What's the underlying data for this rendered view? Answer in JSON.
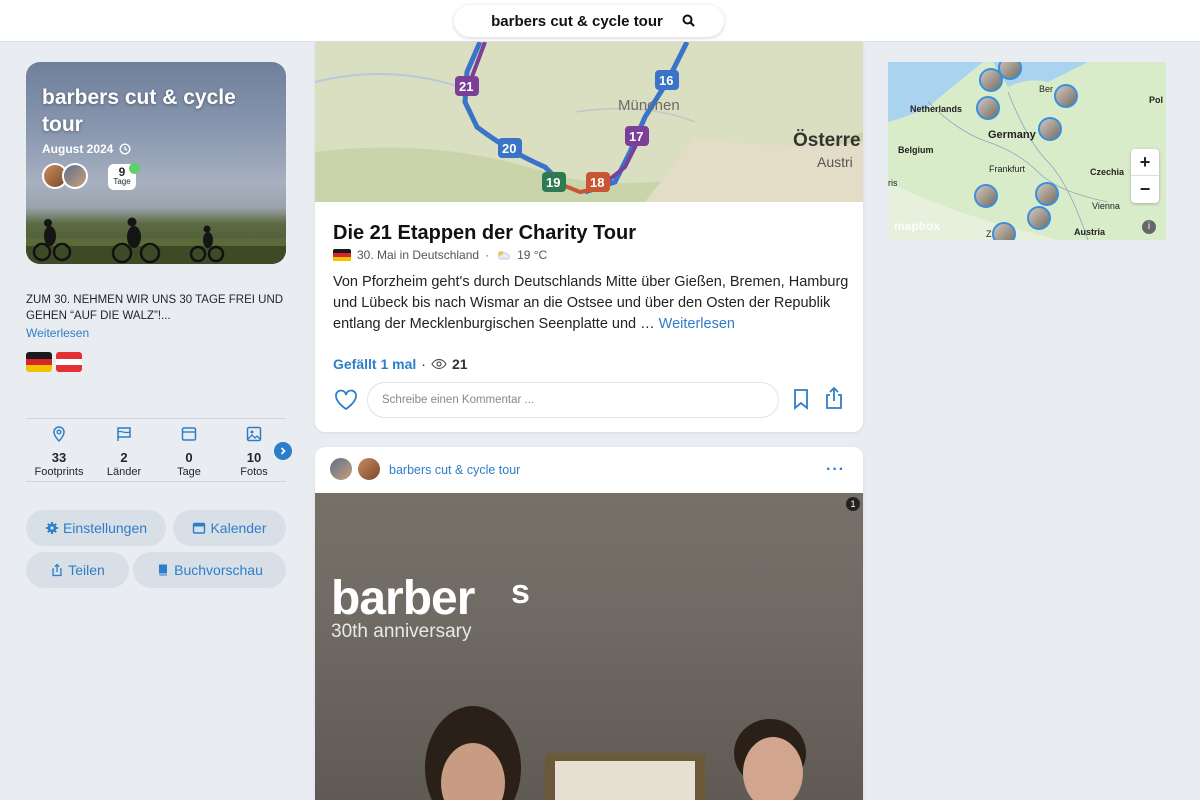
{
  "header": {
    "search_text": "barbers cut & cycle tour",
    "search_icon": "search-icon"
  },
  "trip": {
    "title": "barbers cut & cycle tour",
    "date": "August 2024",
    "days_badge_number": "9",
    "days_badge_label": "Tage",
    "description": "ZUM 30. NEHMEN WIR UNS 30 TAGE FREI UND GEHEN “AUF DIE WALZ”!...",
    "read_more": "Weiterlesen",
    "flags": [
      "de-flag",
      "at-flag"
    ]
  },
  "stats": [
    {
      "icon": "pin-icon",
      "value": "33",
      "label": "Footprints"
    },
    {
      "icon": "flag-icon",
      "value": "2",
      "label": "Länder"
    },
    {
      "icon": "calendar-icon",
      "value": "0",
      "label": "Tage"
    },
    {
      "icon": "photo-icon",
      "value": "10",
      "label": "Fotos"
    }
  ],
  "actions": {
    "settings": "Einstellungen",
    "calendar": "Kalender",
    "share": "Teilen",
    "book_preview": "Buchvorschau"
  },
  "post1": {
    "title": "Die 21 Etappen der Charity Tour",
    "date_location": "30. Mai in Deutschland",
    "weather": "19 °C",
    "body": "Von Pforzheim geht's durch Deutschlands Mitte über Gießen, Bremen, Hamburg und Lübeck bis nach Wismar an die Ostsee und über den Osten der Republik entlang der Mecklenburgischen Seenplatte und …",
    "read_more": "Weiterlesen",
    "likes": "Gefällt 1 mal",
    "views": "21",
    "comment_placeholder": "Schreibe einen Kommentar ...",
    "map": {
      "stage_markers": [
        "21",
        "20",
        "19",
        "18",
        "17",
        "16"
      ],
      "city_label": "München",
      "country_label": "Österre",
      "country_label_sub": "Austri"
    }
  },
  "post2": {
    "author": "barbers cut & cycle tour",
    "photo_count": "1",
    "photo_text_main": "barber",
    "photo_text_s": "s",
    "photo_text_sub": "30th anniversary"
  },
  "overview_map": {
    "labels": {
      "netherlands": "Netherlands",
      "germany": "Germany",
      "belgium": "Belgium",
      "frankfurt": "Frankfurt",
      "czechia": "Czechia",
      "vienna": "Vienna",
      "austria": "Austria",
      "berlin": "Ber",
      "poland": "Pol",
      "paris": "ris",
      "zurich": "Z"
    },
    "zoom_in": "+",
    "zoom_out": "−",
    "attribution": "mapbox",
    "info": "i"
  },
  "colors": {
    "accent": "#2d7ec9",
    "background": "#e9edf2"
  }
}
